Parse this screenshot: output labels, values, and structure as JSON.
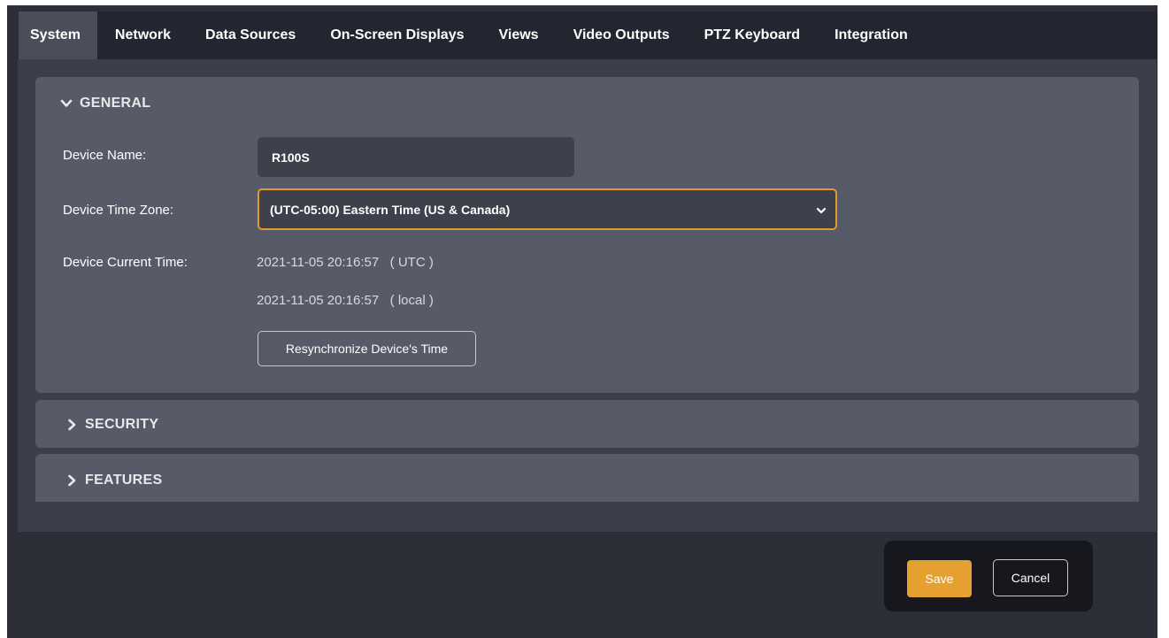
{
  "tabs": [
    {
      "label": "System",
      "active": true
    },
    {
      "label": "Network"
    },
    {
      "label": "Data Sources"
    },
    {
      "label": "On-Screen Displays"
    },
    {
      "label": "Views"
    },
    {
      "label": "Video Outputs"
    },
    {
      "label": "PTZ Keyboard"
    },
    {
      "label": "Integration"
    }
  ],
  "general": {
    "header": "GENERAL",
    "device_name_label": "Device Name:",
    "device_name_value": "R100S",
    "time_zone_label": "Device Time Zone:",
    "time_zone_value": "(UTC-05:00) Eastern Time (US & Canada)",
    "current_time_label": "Device Current Time:",
    "utc_time": "2021-11-05 20:16:57   ( UTC )",
    "local_time": "2021-11-05 20:16:57   ( local )",
    "resync_button": "Resynchronize Device's Time"
  },
  "security": {
    "header": "SECURITY"
  },
  "features": {
    "header": "FEATURES"
  },
  "actions": {
    "save": "Save",
    "cancel": "Cancel"
  },
  "colors": {
    "accent": "#e6a030",
    "panel": "#575b67",
    "background": "#2c2f38"
  },
  "icons": {
    "expanded": "chevron-down-icon",
    "collapsed": "chevron-right-icon",
    "select": "caret-down-icon"
  }
}
